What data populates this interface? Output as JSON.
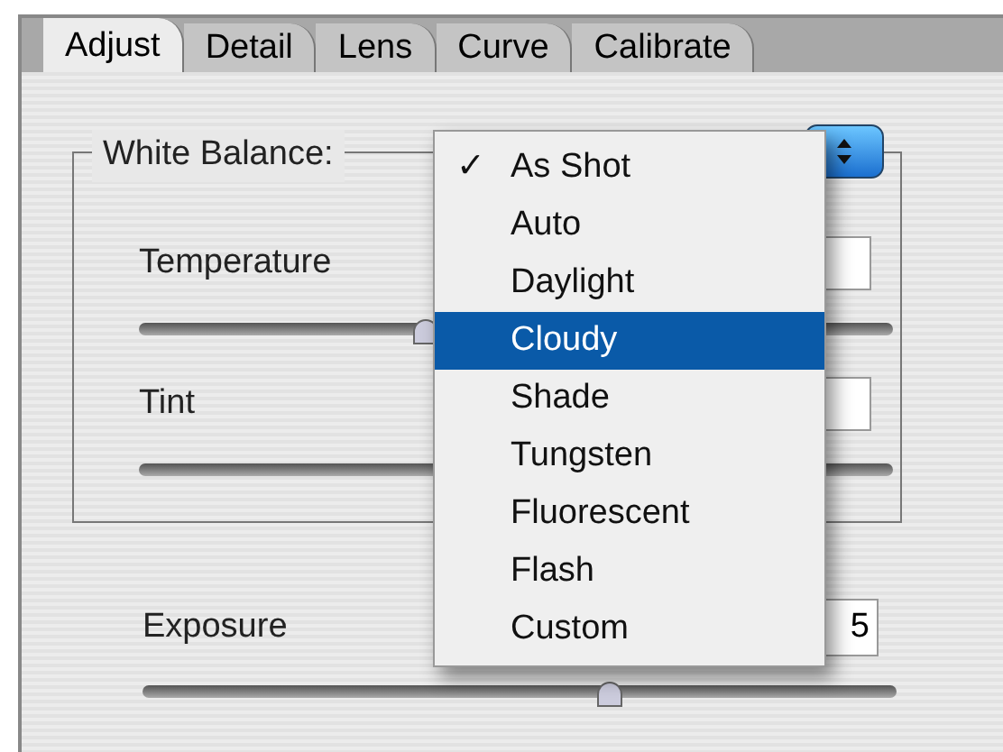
{
  "tabs": [
    {
      "label": "Adjust",
      "selected": true
    },
    {
      "label": "Detail",
      "selected": false
    },
    {
      "label": "Lens",
      "selected": false
    },
    {
      "label": "Curve",
      "selected": false
    },
    {
      "label": "Calibrate",
      "selected": false
    }
  ],
  "white_balance": {
    "label": "White Balance:",
    "menu": [
      {
        "label": "As Shot",
        "checked": true,
        "selected": false
      },
      {
        "label": "Auto",
        "checked": false,
        "selected": false
      },
      {
        "label": "Daylight",
        "checked": false,
        "selected": false
      },
      {
        "label": "Cloudy",
        "checked": false,
        "selected": true
      },
      {
        "label": "Shade",
        "checked": false,
        "selected": false
      },
      {
        "label": "Tungsten",
        "checked": false,
        "selected": false
      },
      {
        "label": "Fluorescent",
        "checked": false,
        "selected": false
      },
      {
        "label": "Flash",
        "checked": false,
        "selected": false
      },
      {
        "label": "Custom",
        "checked": false,
        "selected": false
      }
    ],
    "check_mark": "✓",
    "sliders": [
      {
        "label": "Temperature",
        "level": 0.38
      },
      {
        "label": "Tint"
      }
    ]
  },
  "exposure": {
    "label": "Exposure",
    "value": "5",
    "level": 0.62
  }
}
